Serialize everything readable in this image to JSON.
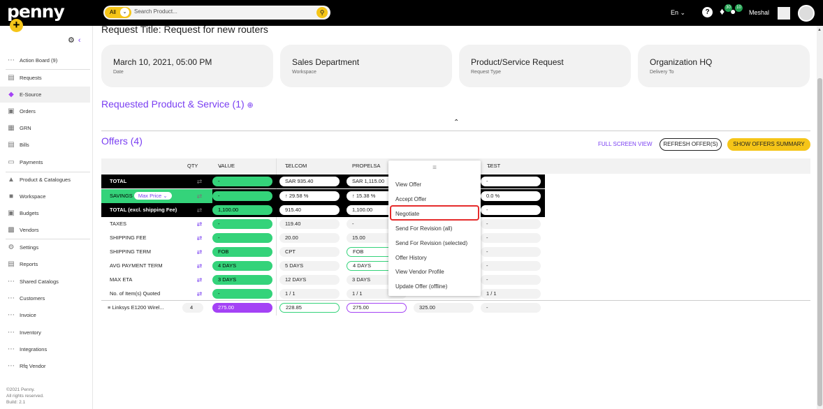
{
  "app": {
    "logo": "penny"
  },
  "search": {
    "scope": "All",
    "placeholder": "Search Product..."
  },
  "topbar": {
    "lang": "En",
    "notif_count": "30",
    "chat_count": "10",
    "user": "Meshal"
  },
  "sidebar": {
    "items": [
      {
        "label": "Action Board (9)",
        "icon": "dots-icon"
      },
      {
        "label": "Requests",
        "icon": "document-icon"
      },
      {
        "label": "E-Source",
        "icon": "tag-icon"
      },
      {
        "label": "Orders",
        "icon": "cart-icon"
      },
      {
        "label": "GRN",
        "icon": "grid-icon"
      },
      {
        "label": "Bills",
        "icon": "bill-icon"
      },
      {
        "label": "Payments",
        "icon": "payment-icon"
      },
      {
        "label": "Product & Catalogues",
        "icon": "box-icon"
      },
      {
        "label": "Workspace",
        "icon": "briefcase-icon"
      },
      {
        "label": "Budgets",
        "icon": "budget-icon"
      },
      {
        "label": "Vendors",
        "icon": "store-icon"
      },
      {
        "label": "Settings",
        "icon": "gear-icon"
      },
      {
        "label": "Reports",
        "icon": "report-icon"
      },
      {
        "label": "Shared Catalogs",
        "icon": "dots-icon"
      },
      {
        "label": "Customers",
        "icon": "dots-icon"
      },
      {
        "label": "Invoice",
        "icon": "dots-icon"
      },
      {
        "label": "Inventory",
        "icon": "dots-icon"
      },
      {
        "label": "Integrations",
        "icon": "dots-icon"
      },
      {
        "label": "Rfq Vendor",
        "icon": "dots-icon"
      }
    ],
    "footer": [
      "©2021 Penny.",
      "All rights reserved.",
      "Build: 2.1"
    ]
  },
  "request": {
    "title": "Request Title: Request for new routers"
  },
  "cards": [
    {
      "value": "March 10, 2021, 05:00 PM",
      "label": "Date"
    },
    {
      "value": "Sales Department",
      "label": "Workspace"
    },
    {
      "value": "Product/Service Request",
      "label": "Request Type"
    },
    {
      "value": "Organization HQ",
      "label": "Delivery To"
    }
  ],
  "sections": {
    "products": "Requested Product & Service (1)",
    "offers": "Offers (4)"
  },
  "actions": {
    "full_screen": "FULL SCREEN VIEW",
    "refresh": "REFRESH OFFER(S)",
    "summary": "SHOW OFFERS SUMMARY"
  },
  "table": {
    "headers": {
      "qty": "QTY",
      "value_basket": "VALUE BASKET",
      "v1": "TELCOM SOL...",
      "v2": "PROPELSA",
      "v4": "TEST PENNY"
    },
    "rows": [
      {
        "label": "TOTAL",
        "vb": "-",
        "v1": "SAR 935.40",
        "v2": "SAR 1,115.00",
        "v4": "-"
      },
      {
        "label": "SAVINGS",
        "savings_select": "Max Price",
        "vb": "-",
        "v1": "29.58 %",
        "v2": "15.38 %",
        "v4": "0.0 %"
      },
      {
        "label": "TOTAL (excl. shipping Fee)",
        "vb": "1,100.00",
        "v1": "915.40",
        "v2": "1,100.00",
        "v4": "-"
      },
      {
        "label": "TAXES",
        "vb": "-",
        "v1": "119.40",
        "v2": "-",
        "v4": "-"
      },
      {
        "label": "SHIPPING FEE",
        "vb": "-",
        "v1": "20.00",
        "v2": "15.00",
        "v4": "-"
      },
      {
        "label": "SHIPPING TERM",
        "vb": "FOB",
        "v1": "CPT",
        "v2": "FOB",
        "v4": "-"
      },
      {
        "label": "AVG PAYMENT TERM",
        "vb": "4 DAYS",
        "v1": "5 DAYS",
        "v2": "4 DAYS",
        "v4": "-"
      },
      {
        "label": "MAX ETA",
        "vb": "3 DAYS",
        "v1": "12 DAYS",
        "v2": "3 DAYS",
        "v4": "-"
      },
      {
        "label": "No. of Item(s) Quoted",
        "vb": "-",
        "v1": "1 / 1",
        "v2": "1 / 1",
        "v4": "1 / 1"
      }
    ],
    "item": {
      "name": "Linksys E1200 Wirel...",
      "qty": "4",
      "vb": "275.00",
      "v1": "228.85",
      "v2": "275.00",
      "v3": "325.00",
      "v4": "-"
    }
  },
  "menu": {
    "items": [
      "View Offer",
      "Accept Offer",
      "Negotiate",
      "Send For Revision (all)",
      "Send For Revision (selected)",
      "Offer History",
      "View Vendor Profile",
      "Update Offer (offline)"
    ],
    "highlighted": "Negotiate"
  },
  "colors": {
    "accent": "#7a3ff2",
    "brand_yellow": "#f5c518",
    "green": "#34d37a",
    "purple": "#a442f5",
    "highlight": "#e52b2b"
  }
}
